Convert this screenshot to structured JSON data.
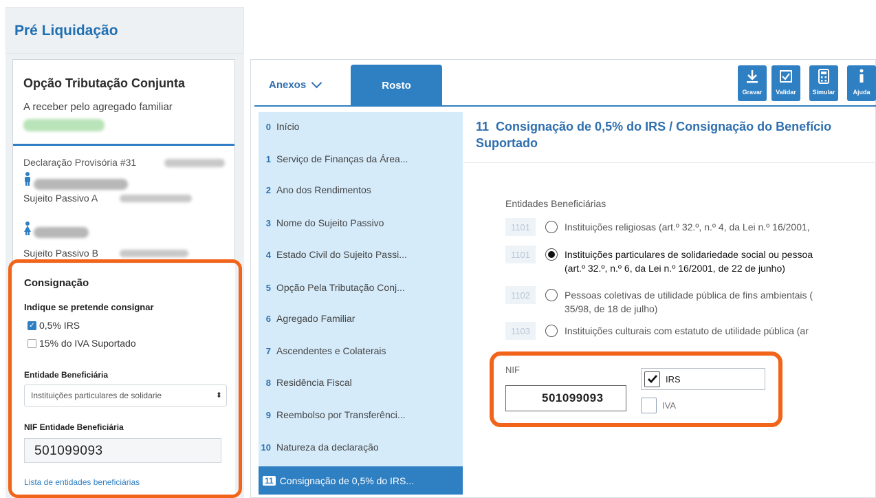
{
  "left": {
    "header_title": "Pré Liquidação",
    "card_title": "Opção Tributação Conjunta",
    "card_sub": "A receber pelo agregado familiar",
    "declaration": "Declaração Provisória #31",
    "sp_a": "Sujeito Passivo A",
    "sp_b": "Sujeito Passivo B",
    "consignacao": {
      "title": "Consignação",
      "question": "Indique se pretende consignar",
      "opt_irs": "0,5% IRS",
      "opt_irs_checked": true,
      "opt_iva": "15% do IVA Suportado",
      "opt_iva_checked": false,
      "entidade_label": "Entidade Beneficiária",
      "entidade_value": "Instituições particulares de solidarie",
      "select_arrow": "⬍",
      "nif_label": "NIF Entidade Beneficiária",
      "nif_value": "501099093",
      "link": "Lista de entidades beneficiárias"
    }
  },
  "tabs": {
    "anexos": "Anexos",
    "rosto": "Rosto"
  },
  "toolbar": {
    "gravar": "Gravar",
    "validar": "Validar",
    "simular": "Simular",
    "ajuda": "Ajuda"
  },
  "nav": [
    {
      "num": "0",
      "label": "Início"
    },
    {
      "num": "1",
      "label": "Serviço de Finanças da Área..."
    },
    {
      "num": "2",
      "label": "Ano dos Rendimentos"
    },
    {
      "num": "3",
      "label": "Nome do Sujeito Passivo"
    },
    {
      "num": "4",
      "label": "Estado Civil do Sujeito Passi..."
    },
    {
      "num": "5",
      "label": "Opção Pela Tributação Conj..."
    },
    {
      "num": "6",
      "label": "Agregado Familiar"
    },
    {
      "num": "7",
      "label": "Ascendentes e Colaterais"
    },
    {
      "num": "8",
      "label": "Residência Fiscal"
    },
    {
      "num": "9",
      "label": "Reembolso por Transferênci..."
    },
    {
      "num": "10",
      "label": "Natureza da declaração"
    },
    {
      "num": "11",
      "label": "Consignação de 0,5% do IRS..."
    }
  ],
  "section": {
    "number": "11",
    "title": "Consignação de 0,5% do IRS / Consignação do Benefício Suportado",
    "entidades_label": "Entidades Beneficiárias",
    "options": [
      {
        "code": "1101",
        "line1": "Instituições religiosas (art.º 32.º, n.º 4, da Lei n.º 16/2001,",
        "line2": "",
        "selected": false
      },
      {
        "code": "1101",
        "line1": "Instituições particulares de solidariedade social ou pessoa",
        "line2": "(art.º 32.º, n.º 6, da Lei n.º 16/2001, de 22 de junho)",
        "selected": true
      },
      {
        "code": "1102",
        "line1": "Pessoas coletivas de utilidade pública de fins ambientais (",
        "line2": "35/98, de 18 de julho)",
        "selected": false
      },
      {
        "code": "1103",
        "line1": "Instituições culturais com estatuto de utilidade pública (ar",
        "line2": "",
        "selected": false
      }
    ],
    "nif_label": "NIF",
    "nif_value": "501099093",
    "irs_label": "IRS",
    "irs_checked": true,
    "iva_label": "IVA",
    "iva_checked": false
  },
  "colors": {
    "accent": "#2f7fc3",
    "highlight": "#f26419",
    "sidebar": "#d5ebfa"
  }
}
